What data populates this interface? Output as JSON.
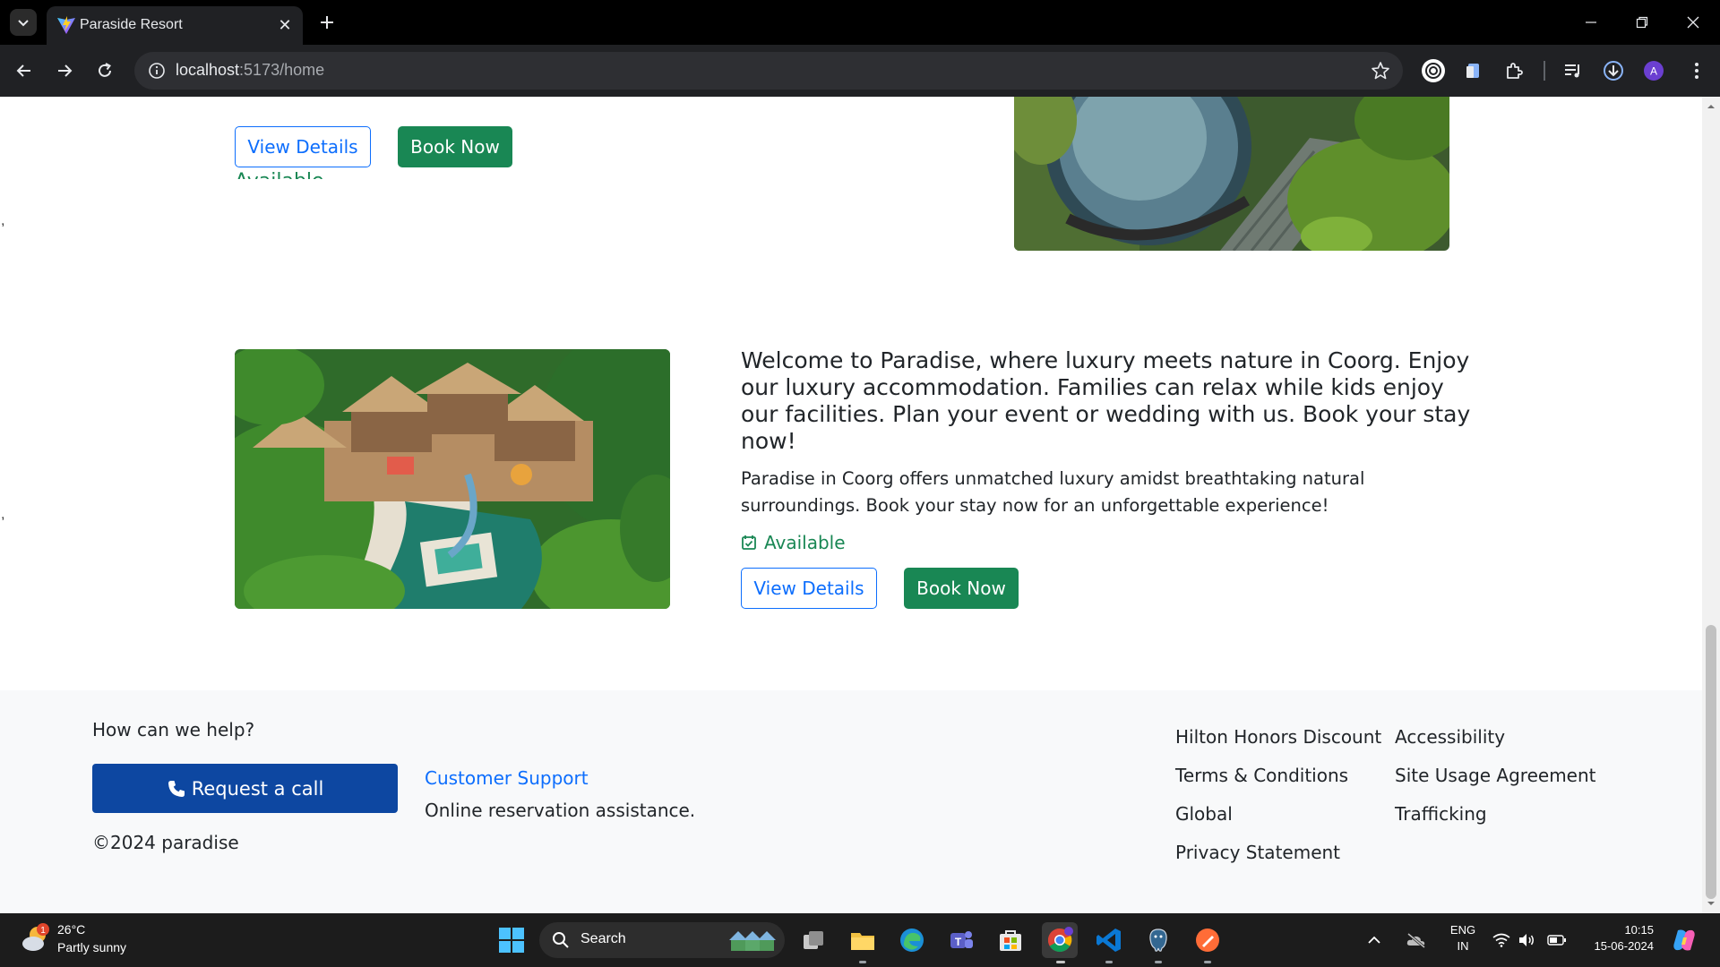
{
  "browser": {
    "tab_title": "Paraside Resort",
    "url_host": "localhost",
    "url_path": ":5173/home"
  },
  "page": {
    "prev_card": {
      "availability": "Available",
      "view_details_label": "View Details",
      "book_now_label": "Book Now"
    },
    "card": {
      "title": "Welcome to Paradise, where luxury meets nature in Coorg. Enjoy our luxury accommodation. Families can relax while kids enjoy our facilities. Plan your event or wedding with us. Book your stay now!",
      "description": "Paradise in Coorg offers unmatched luxury amidst breathtaking natural surroundings. Book your stay now for an unforgettable experience!",
      "availability": "Available",
      "view_details_label": "View Details",
      "book_now_label": "Book Now"
    },
    "stray_marks": [
      ",",
      ","
    ]
  },
  "footer": {
    "help_text": "How can we help?",
    "request_call_label": "Request a call",
    "copyright": "©2024 paradise",
    "support_title": "Customer Support",
    "support_desc": "Online reservation assistance.",
    "links_col1": [
      "Hilton Honors Discount",
      "Terms & Conditions",
      "Global",
      "Privacy Statement"
    ],
    "links_col2": [
      "Accessibility",
      "Site Usage Agreement",
      "Trafficking"
    ]
  },
  "taskbar": {
    "weather_badge": "1",
    "weather_temp": "26°C",
    "weather_desc": "Partly sunny",
    "search_label": "Search",
    "lang_line1": "ENG",
    "lang_line2": "IN",
    "time": "10:15",
    "date": "15-06-2024"
  },
  "colors": {
    "primary": "#0d6efd",
    "success": "#198754",
    "request_button": "#0d47a1",
    "footer_bg": "#f8f9fa"
  }
}
